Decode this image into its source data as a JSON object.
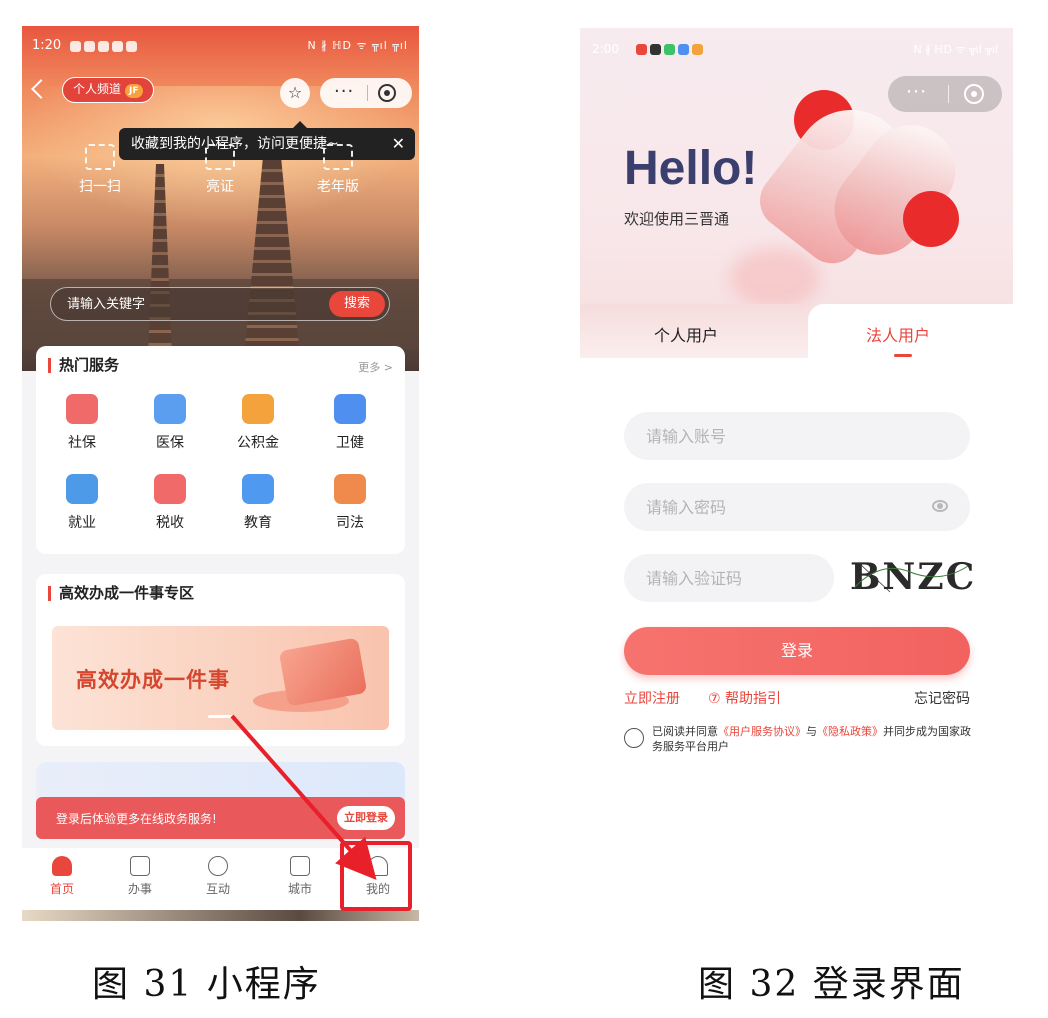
{
  "left": {
    "status_time": "1:20",
    "status_right": "N ∦ ℍD ᯤ ╦ıl ╦ıl",
    "channel_label": "个人频道",
    "channel_badge": "JF",
    "star_glyph": "☆",
    "more_glyph": "···",
    "tooltip_text": "收藏到我的小程序，访问更便捷~",
    "tooltip_close": "✕",
    "quick_actions": [
      "扫一扫",
      "亮证",
      "老年版"
    ],
    "search_placeholder": "请输入关键字",
    "search_button": "搜索",
    "hot_title": "热门服务",
    "hot_more": "更多 >",
    "services": [
      "社保",
      "医保",
      "公积金",
      "卫健",
      "就业",
      "税收",
      "教育",
      "司法"
    ],
    "service_colors": [
      "#f06a6a",
      "#5b9ef0",
      "#f4a23c",
      "#4f8ff0",
      "#4d9be8",
      "#f06a6a",
      "#4f9af0",
      "#f08a4c"
    ],
    "zone_title": "高效办成一件事专区",
    "banner_text": "高效办成一件事",
    "login_strip_text": "登录后体验更多在线政务服务!",
    "login_strip_button": "立即登录",
    "tabs": [
      "首页",
      "办事",
      "互动",
      "城市",
      "我的"
    ],
    "caption": "图 31 小程序",
    "accent": "#e9463c",
    "annotation_color": "#e8202a"
  },
  "right": {
    "status_time": "2:00",
    "status_right": "N ∦ ℍD ᯤ ╦ıl ╦ıl",
    "status_dot_colors": [
      "#e9463c",
      "#333333",
      "#3cc26a",
      "#4f8ff0",
      "#f4a23c"
    ],
    "more_glyph": "···",
    "hello": "Hello!",
    "welcome": "欢迎使用三晋通",
    "tab_personal": "个人用户",
    "tab_legal": "法人用户",
    "account_placeholder": "请输入账号",
    "password_placeholder": "请输入密码",
    "captcha_placeholder": "请输入验证码",
    "captcha_code": "BNZC",
    "login_button": "登录",
    "register_link": "立即注册",
    "help_link": "⑦ 帮助指引",
    "forgot_link": "忘记密码",
    "agree_prefix": "已阅读并同意",
    "agree_terms": "《用户服务协议》",
    "agree_and": "与",
    "agree_privacy": "《隐私政策》",
    "agree_suffix": "并同步成为国家政务服务平台用户",
    "caption": "图 32 登录界面",
    "brand_dark": "#3a3f6e",
    "accent": "#e9463c"
  }
}
